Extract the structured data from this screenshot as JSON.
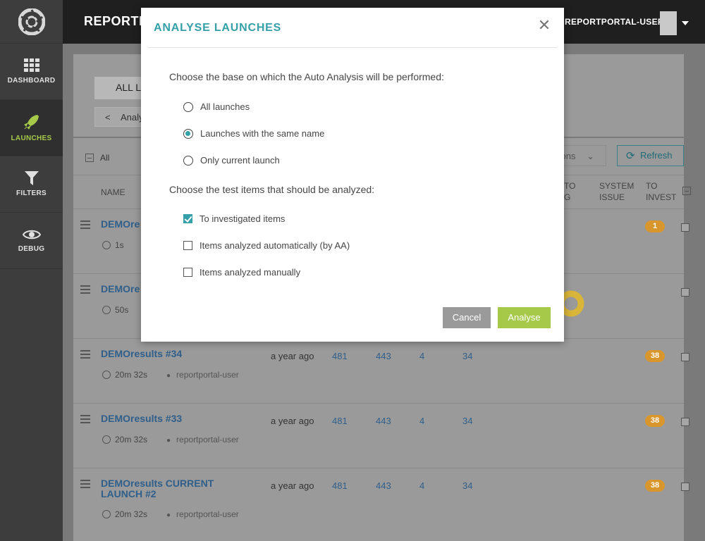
{
  "sidebar": {
    "logo_icon": "aperture-logo-icon",
    "items": [
      {
        "label": "DASHBOARD",
        "icon": "grid-icon"
      },
      {
        "label": "LAUNCHES",
        "icon": "rocket-icon"
      },
      {
        "label": "FILTERS",
        "icon": "funnel-icon"
      },
      {
        "label": "DEBUG",
        "icon": "eye-icon"
      }
    ],
    "accent": "#a6c94a"
  },
  "header": {
    "project": "REPORTPC",
    "user": "REPORTPORTAL-USER"
  },
  "toolbar": {
    "tab_all": "ALL LAU",
    "tab_analysis": "Analysi",
    "all_label": "All",
    "actions_label": "tions",
    "refresh_label": "Refresh"
  },
  "columns": {
    "name": "NAME",
    "to_bug": "TO\nG",
    "system_issue": "SYSTEM\nISSUE",
    "to_invest": "TO\nINVEST"
  },
  "rows": [
    {
      "name": "DEMOre",
      "duration": "1s"
    },
    {
      "name": "DEMOre",
      "duration": "50s"
    },
    {
      "name": "DEMOresults #34",
      "duration": "20m 32s",
      "user": "reportportal-user",
      "ago": "a year ago",
      "total": "481",
      "passed": "443",
      "failed": "4",
      "skipped": "34",
      "invest": "38"
    },
    {
      "name": "DEMOresults #33",
      "duration": "20m 32s",
      "user": "reportportal-user",
      "ago": "a year ago",
      "total": "481",
      "passed": "443",
      "failed": "4",
      "skipped": "34",
      "invest": "38"
    },
    {
      "name": "DEMOresults CURRENT LAUNCH #2",
      "duration": "20m 32s",
      "user": "reportportal-user",
      "ago": "a year ago",
      "total": "481",
      "passed": "443",
      "failed": "4",
      "skipped": "34",
      "invest": "38"
    }
  ],
  "row1_invest": "1",
  "modal": {
    "title": "ANALYSE LAUNCHES",
    "q1": "Choose the base on which the Auto Analysis will be performed:",
    "base_options": [
      {
        "label": "All launches",
        "selected": false
      },
      {
        "label": "Launches with the same name",
        "selected": true
      },
      {
        "label": "Only current launch",
        "selected": false
      }
    ],
    "q2": "Choose the test items that should be analyzed:",
    "item_options": [
      {
        "label": "To investigated items",
        "checked": true
      },
      {
        "label": "Items analyzed automatically (by AA)",
        "checked": false
      },
      {
        "label": "Items analyzed manually",
        "checked": false
      }
    ],
    "cancel": "Cancel",
    "analyse": "Analyse",
    "accent": "#35a0a8"
  }
}
